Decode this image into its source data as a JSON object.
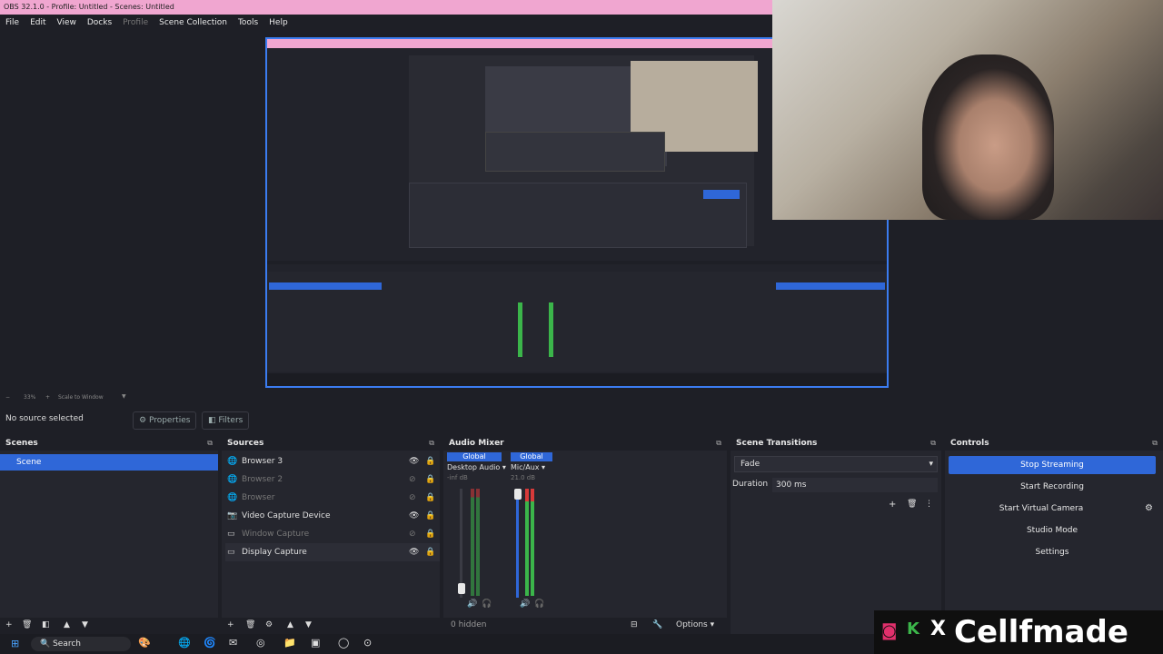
{
  "window": {
    "title": "OBS 32.1.0 - Profile: Untitled - Scenes: Untitled"
  },
  "menu": [
    {
      "label": "File",
      "enabled": true
    },
    {
      "label": "Edit",
      "enabled": true
    },
    {
      "label": "View",
      "enabled": true
    },
    {
      "label": "Docks",
      "enabled": true
    },
    {
      "label": "Profile",
      "enabled": false
    },
    {
      "label": "Scene Collection",
      "enabled": true
    },
    {
      "label": "Tools",
      "enabled": true
    },
    {
      "label": "Help",
      "enabled": true
    }
  ],
  "preview_toolbar": {
    "zoom": "33%",
    "scale_mode": "Scale to Window"
  },
  "source_bar": {
    "status": "No source selected",
    "properties": "Properties",
    "filters": "Filters"
  },
  "scenes": {
    "title": "Scenes",
    "items": [
      "Scene"
    ]
  },
  "sources": {
    "title": "Sources",
    "items": [
      {
        "name": "Browser 3",
        "visible": true
      },
      {
        "name": "Browser 2",
        "visible": false
      },
      {
        "name": "Browser",
        "visible": false
      },
      {
        "name": "Video Capture Device",
        "visible": true
      },
      {
        "name": "Window Capture",
        "visible": false
      },
      {
        "name": "Display Capture",
        "visible": true
      }
    ]
  },
  "audio_mixer": {
    "title": "Audio Mixer",
    "channels": [
      {
        "tag": "Global",
        "name": "Desktop Audio",
        "level": "-inf dB",
        "volume_fraction": 0.05
      },
      {
        "tag": "Global",
        "name": "Mic/Aux",
        "level": "21.0 dB",
        "volume_fraction": 0.95
      }
    ],
    "scale": [
      "0",
      "-6",
      "-12",
      "-18",
      "-24",
      "-30",
      "-36",
      "-42",
      "-48",
      "-54",
      "-60"
    ],
    "hidden": "0 hidden",
    "options": "Options"
  },
  "transitions": {
    "title": "Scene Transitions",
    "selected": "Fade",
    "duration_label": "Duration",
    "duration": "300 ms"
  },
  "controls": {
    "title": "Controls",
    "stop_streaming": "Stop Streaming",
    "start_recording": "Start Recording",
    "start_virtual_camera": "Start Virtual Camera",
    "studio_mode": "Studio Mode",
    "settings": "Settings"
  },
  "taskbar": {
    "search": "Search"
  },
  "brand": {
    "text": "Cellfmade"
  },
  "colors": {
    "accent": "#2f67d8",
    "meter_green": "#3bb54a",
    "meter_red": "#d83a3a",
    "title_pink": "#f0a6d0"
  }
}
